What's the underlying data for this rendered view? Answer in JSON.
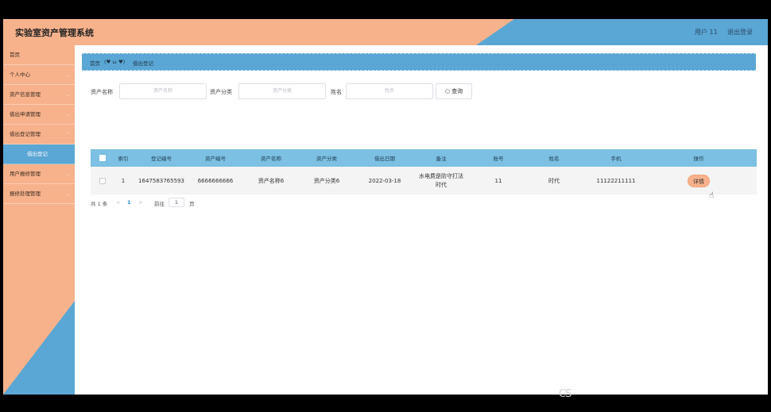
{
  "header": {
    "title": "实验室资产管理系统",
    "user": "用户 11",
    "logout": "退出登录"
  },
  "sidebar": {
    "items": [
      {
        "label": "首页",
        "chevron": ""
      },
      {
        "label": "个人中心",
        "chevron": "⌄"
      },
      {
        "label": "资产信息管理",
        "chevron": "⌄"
      },
      {
        "label": "借出申请管理",
        "chevron": "⌄"
      },
      {
        "label": "借出登记管理",
        "chevron": "⌃"
      },
      {
        "label": "借出登记",
        "chevron": ""
      },
      {
        "label": "用户报修管理",
        "chevron": "⌄"
      },
      {
        "label": "报修处理管理",
        "chevron": "⌄"
      }
    ]
  },
  "breadcrumb": {
    "home": "首页",
    "sep": "(♥ ω ♥)",
    "current": "借出登记"
  },
  "search": {
    "asset_name_label": "资产名称",
    "asset_name_placeholder": "资产名称",
    "asset_category_label": "资产分类",
    "asset_category_placeholder": "资产分类",
    "name_label": "姓名",
    "name_placeholder": "姓名",
    "query_icon": "search-icon",
    "query_label": "查询"
  },
  "table": {
    "columns": [
      "索引",
      "登记编号",
      "资产编号",
      "资产名称",
      "资产分类",
      "借出日期",
      "备注",
      "账号",
      "姓名",
      "手机",
      "操作"
    ],
    "rows": [
      {
        "index": "1",
        "reg_no": "1647583765593",
        "asset_no": "6666666666",
        "asset_name": "资产名称6",
        "asset_category": "资产分类6",
        "lend_date": "2022-03-18",
        "remark": "水电费是防守打法时代",
        "account": "11",
        "name": "时代",
        "phone": "11122211111",
        "action": "详情"
      }
    ]
  },
  "pager": {
    "total": "共 1 条",
    "prev": "<",
    "page": "1",
    "next": ">",
    "goto": "前往",
    "goto_value": "1",
    "page_unit": "页"
  },
  "colors": {
    "peach": "#f7b28c",
    "blue": "#5aa6d4",
    "table_header": "#7cc0e3"
  }
}
